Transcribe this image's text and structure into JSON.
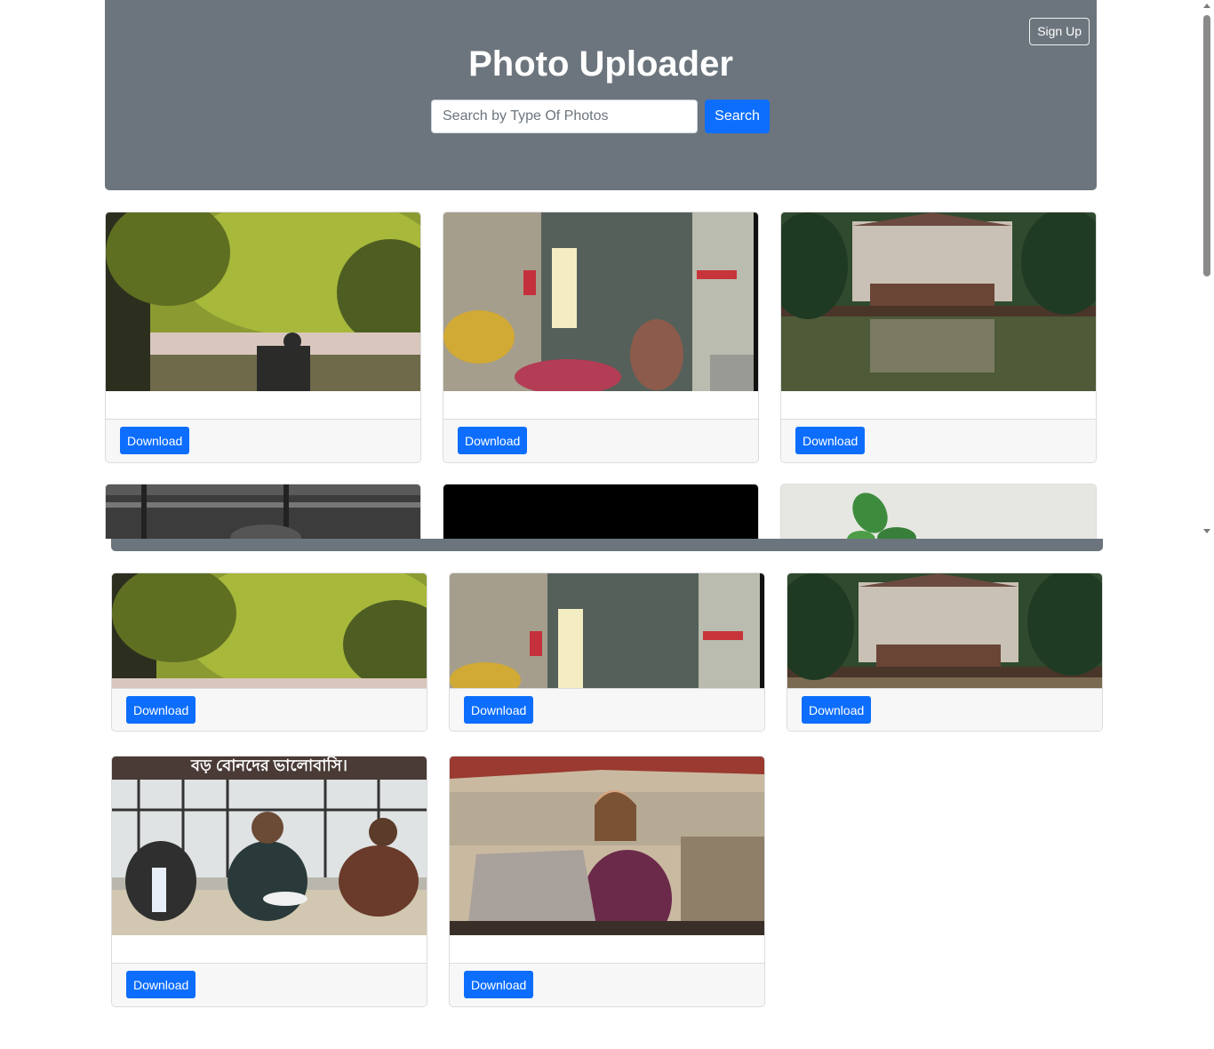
{
  "header": {
    "title": "Photo Uploader",
    "signup_label": "Sign Up",
    "search_placeholder": "Search by Type Of Photos",
    "search_label": "Search"
  },
  "cards": {
    "download_label": "Download"
  },
  "photos": [
    {
      "icon": "park-tree-bicycle-photo"
    },
    {
      "icon": "flower-shop-street-photo"
    },
    {
      "icon": "lake-house-reflection-photo"
    },
    {
      "icon": "black-white-building-photo"
    },
    {
      "icon": "black-photo"
    },
    {
      "icon": "green-plant-photo"
    },
    {
      "icon": "people-eating-photo"
    },
    {
      "icon": "woman-laptop-cafe-photo"
    }
  ],
  "overlay_text": "বড় বোনদের ভালোবাসি।",
  "colors": {
    "header_bg": "#6c757d",
    "primary": "#0d6efd",
    "card_footer": "#f7f7f7"
  }
}
